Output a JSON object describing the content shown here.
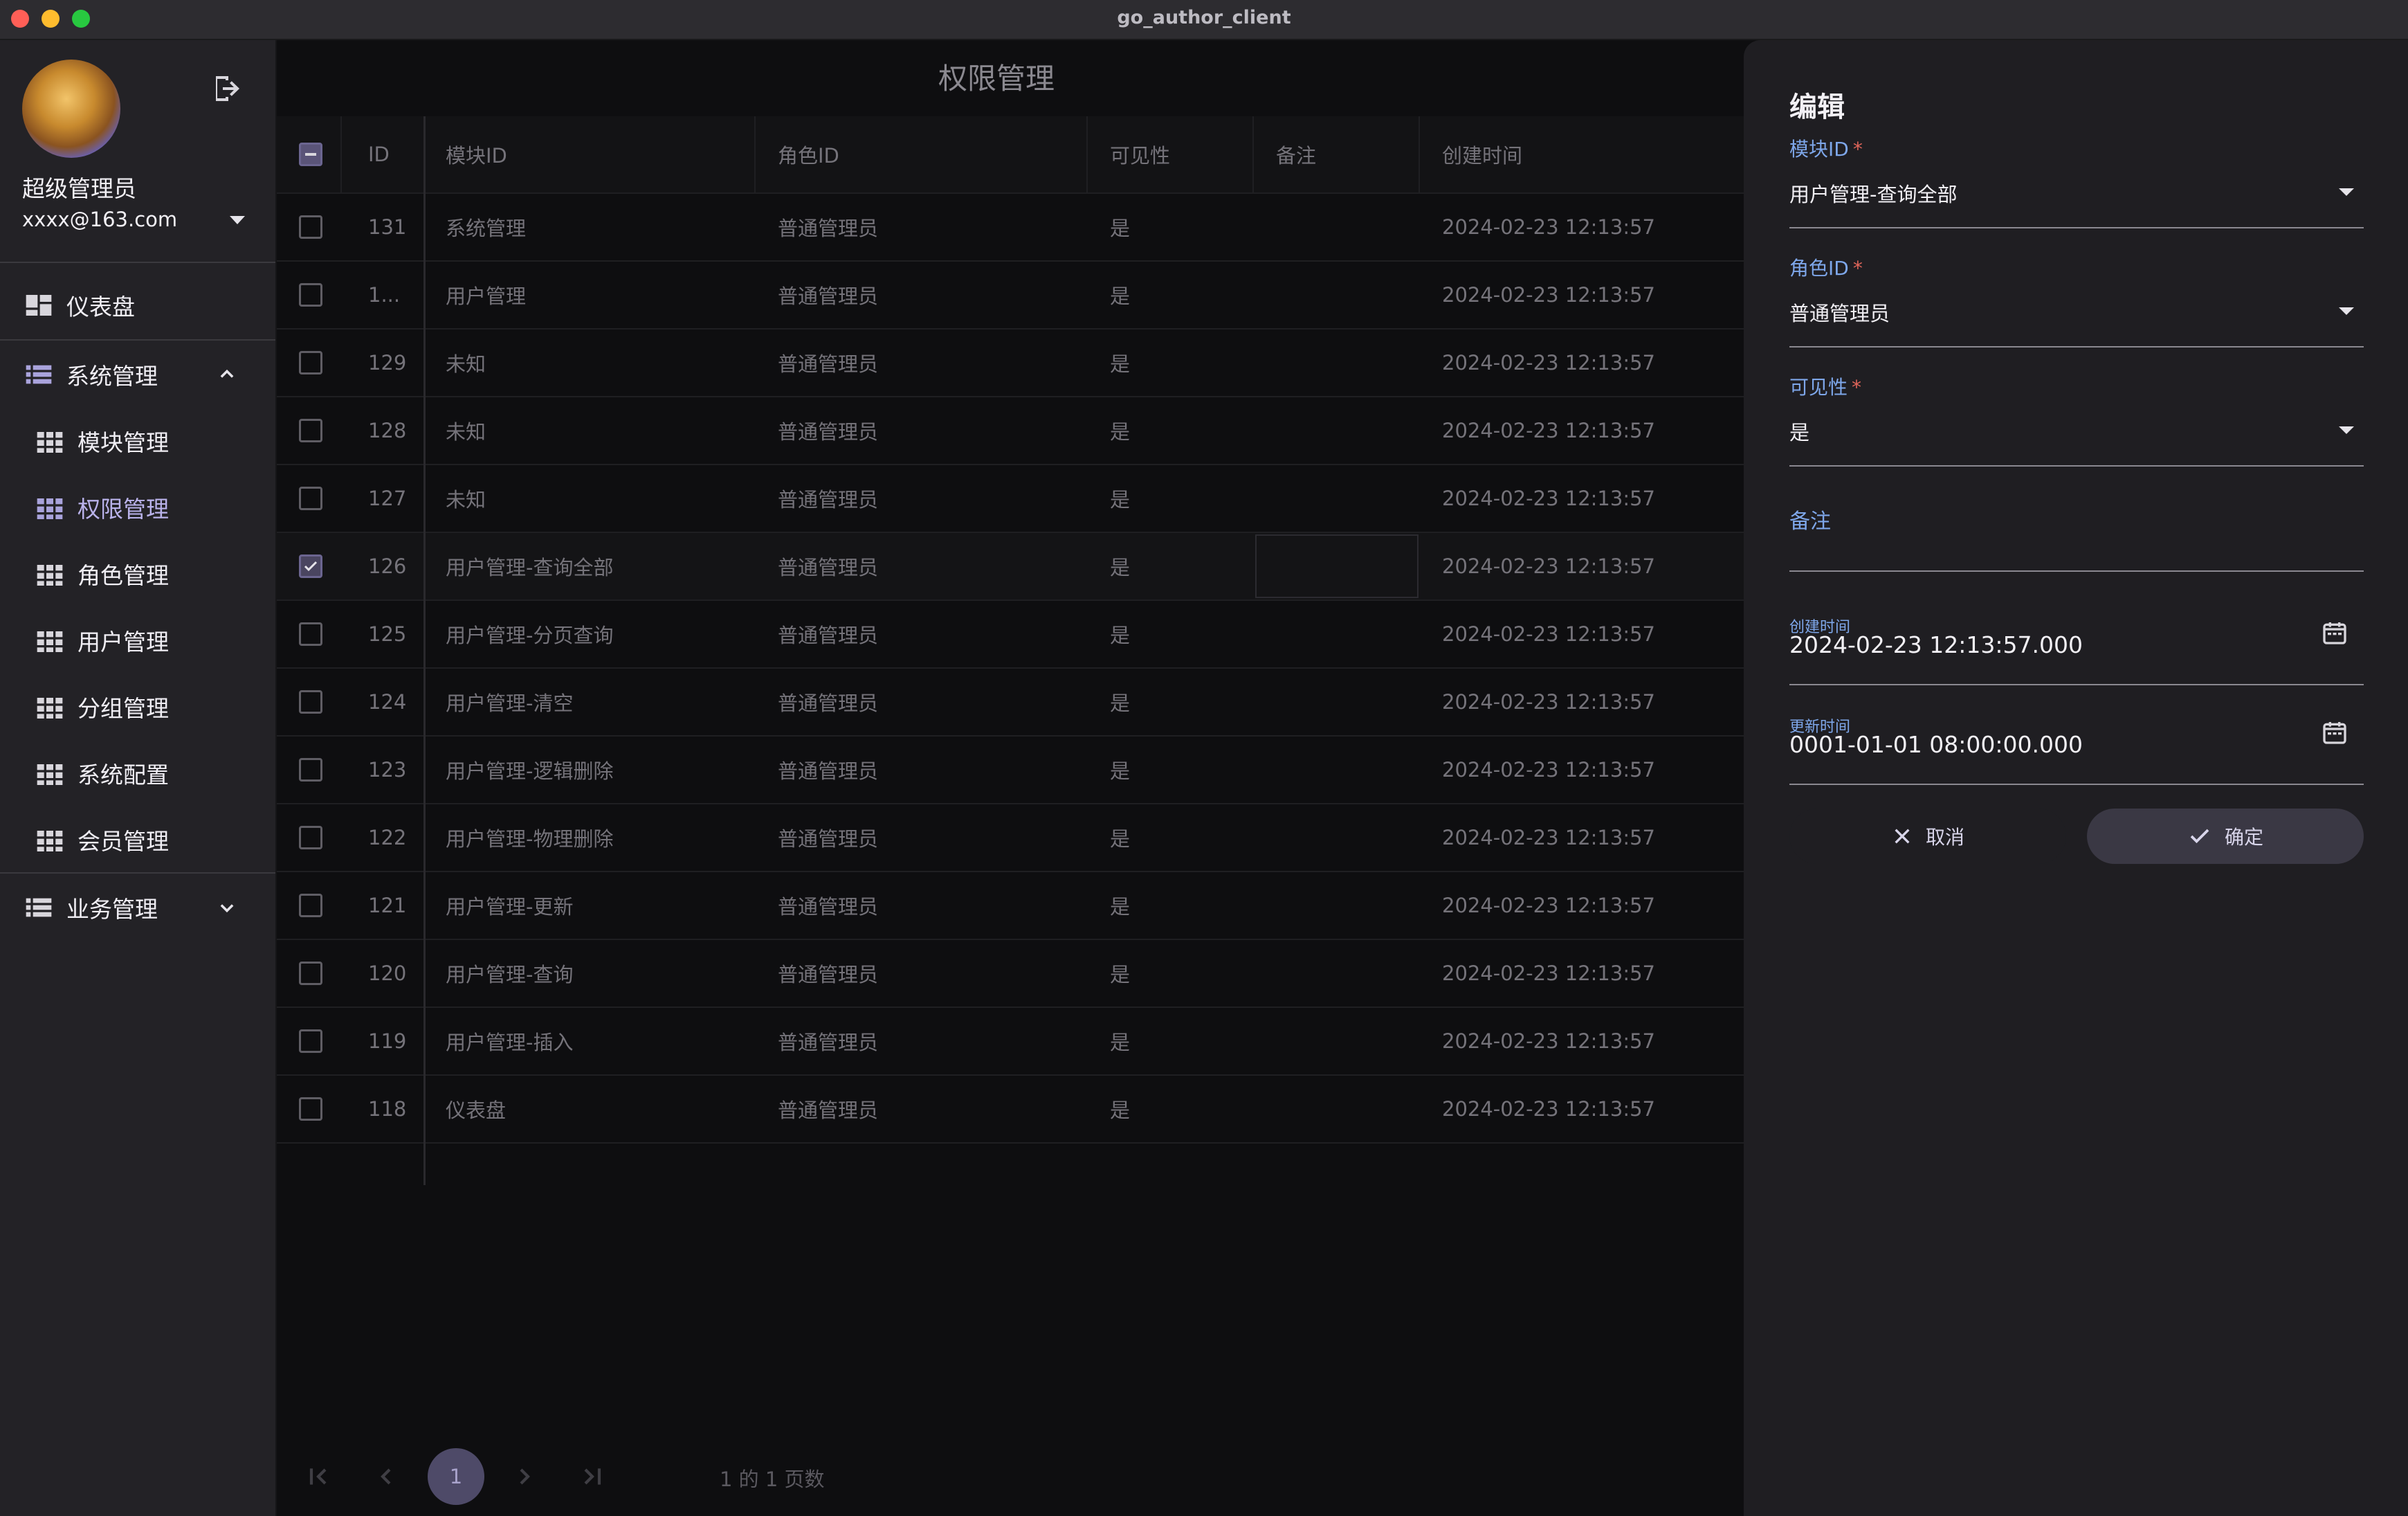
{
  "window": {
    "title": "go_author_client"
  },
  "sidebar": {
    "user_name": "超级管理员",
    "user_email": "xxxx@163.com",
    "items": [
      {
        "label": "仪表盘"
      },
      {
        "label": "系统管理"
      },
      {
        "label": "模块管理"
      },
      {
        "label": "权限管理"
      },
      {
        "label": "角色管理"
      },
      {
        "label": "用户管理"
      },
      {
        "label": "分组管理"
      },
      {
        "label": "系统配置"
      },
      {
        "label": "会员管理"
      },
      {
        "label": "业务管理"
      }
    ],
    "active_item": "权限管理"
  },
  "main": {
    "title": "权限管理",
    "columns": [
      "ID",
      "模块ID",
      "角色ID",
      "可见性",
      "备注",
      "创建时间"
    ],
    "rows": [
      {
        "id": "131",
        "module": "系统管理",
        "role": "普通管理员",
        "visible": "是",
        "remark": "",
        "created": "2024-02-23 12:13:57",
        "checked": false
      },
      {
        "id": "1...",
        "module": "用户管理",
        "role": "普通管理员",
        "visible": "是",
        "remark": "",
        "created": "2024-02-23 12:13:57",
        "checked": false
      },
      {
        "id": "129",
        "module": "未知",
        "role": "普通管理员",
        "visible": "是",
        "remark": "",
        "created": "2024-02-23 12:13:57",
        "checked": false
      },
      {
        "id": "128",
        "module": "未知",
        "role": "普通管理员",
        "visible": "是",
        "remark": "",
        "created": "2024-02-23 12:13:57",
        "checked": false
      },
      {
        "id": "127",
        "module": "未知",
        "role": "普通管理员",
        "visible": "是",
        "remark": "",
        "created": "2024-02-23 12:13:57",
        "checked": false
      },
      {
        "id": "126",
        "module": "用户管理-查询全部",
        "role": "普通管理员",
        "visible": "是",
        "remark": "",
        "created": "2024-02-23 12:13:57",
        "checked": true
      },
      {
        "id": "125",
        "module": "用户管理-分页查询",
        "role": "普通管理员",
        "visible": "是",
        "remark": "",
        "created": "2024-02-23 12:13:57",
        "checked": false
      },
      {
        "id": "124",
        "module": "用户管理-清空",
        "role": "普通管理员",
        "visible": "是",
        "remark": "",
        "created": "2024-02-23 12:13:57",
        "checked": false
      },
      {
        "id": "123",
        "module": "用户管理-逻辑删除",
        "role": "普通管理员",
        "visible": "是",
        "remark": "",
        "created": "2024-02-23 12:13:57",
        "checked": false
      },
      {
        "id": "122",
        "module": "用户管理-物理删除",
        "role": "普通管理员",
        "visible": "是",
        "remark": "",
        "created": "2024-02-23 12:13:57",
        "checked": false
      },
      {
        "id": "121",
        "module": "用户管理-更新",
        "role": "普通管理员",
        "visible": "是",
        "remark": "",
        "created": "2024-02-23 12:13:57",
        "checked": false
      },
      {
        "id": "120",
        "module": "用户管理-查询",
        "role": "普通管理员",
        "visible": "是",
        "remark": "",
        "created": "2024-02-23 12:13:57",
        "checked": false
      },
      {
        "id": "119",
        "module": "用户管理-插入",
        "role": "普通管理员",
        "visible": "是",
        "remark": "",
        "created": "2024-02-23 12:13:57",
        "checked": false
      },
      {
        "id": "118",
        "module": "仪表盘",
        "role": "普通管理员",
        "visible": "是",
        "remark": "",
        "created": "2024-02-23 12:13:57",
        "checked": false
      }
    ],
    "pagination": {
      "current_page": "1",
      "info": "1 的 1 页数"
    }
  },
  "drawer": {
    "title": "编辑",
    "module_label": "模块ID",
    "module_value": "用户管理-查询全部",
    "role_label": "角色ID",
    "role_value": "普通管理员",
    "visible_label": "可见性",
    "visible_value": "是",
    "required_mark": "*",
    "remark_label": "备注",
    "created_label": "创建时间",
    "created_value": "2024-02-23 12:13:57.000",
    "updated_label": "更新时间",
    "updated_value": "0001-01-01 08:00:00.000",
    "cancel_label": "取消",
    "ok_label": "确定"
  },
  "colors": {
    "accent": "#7ea7ea",
    "required": "#e0655a",
    "active_nav": "#b9b2ea",
    "page_chip": "#4e4a68"
  }
}
